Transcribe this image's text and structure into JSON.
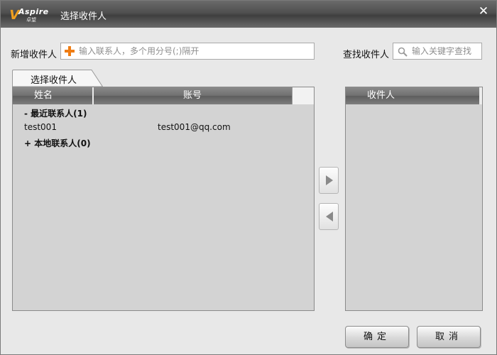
{
  "window": {
    "title": "选择收件人",
    "logo_text": "Aspire",
    "logo_sub": "卓望",
    "close_glyph": "✕"
  },
  "top": {
    "add_label": "新增收件人",
    "add_placeholder": "输入联系人，多个用分号(;)隔开",
    "find_label": "查找收件人",
    "find_placeholder": "输入关键字查找"
  },
  "left_panel": {
    "tab_label": "选择收件人",
    "columns": [
      "姓名",
      "账号"
    ],
    "groups": [
      {
        "label": "- 最近联系人(1)",
        "contacts": [
          {
            "name": "test001",
            "account": "test001@qq.com"
          }
        ]
      },
      {
        "label": "+ 本地联系人(0)",
        "contacts": []
      }
    ]
  },
  "transfer": {
    "add_icon": "arrow-right-icon",
    "remove_icon": "arrow-left-icon"
  },
  "right_panel": {
    "header": "收件人"
  },
  "buttons": {
    "confirm": "确定",
    "cancel": "取消"
  },
  "colors": {
    "accent_orange": "#ef7d14",
    "panel_bg": "#d3d3d3",
    "header_dark": "#6f6f6f"
  }
}
